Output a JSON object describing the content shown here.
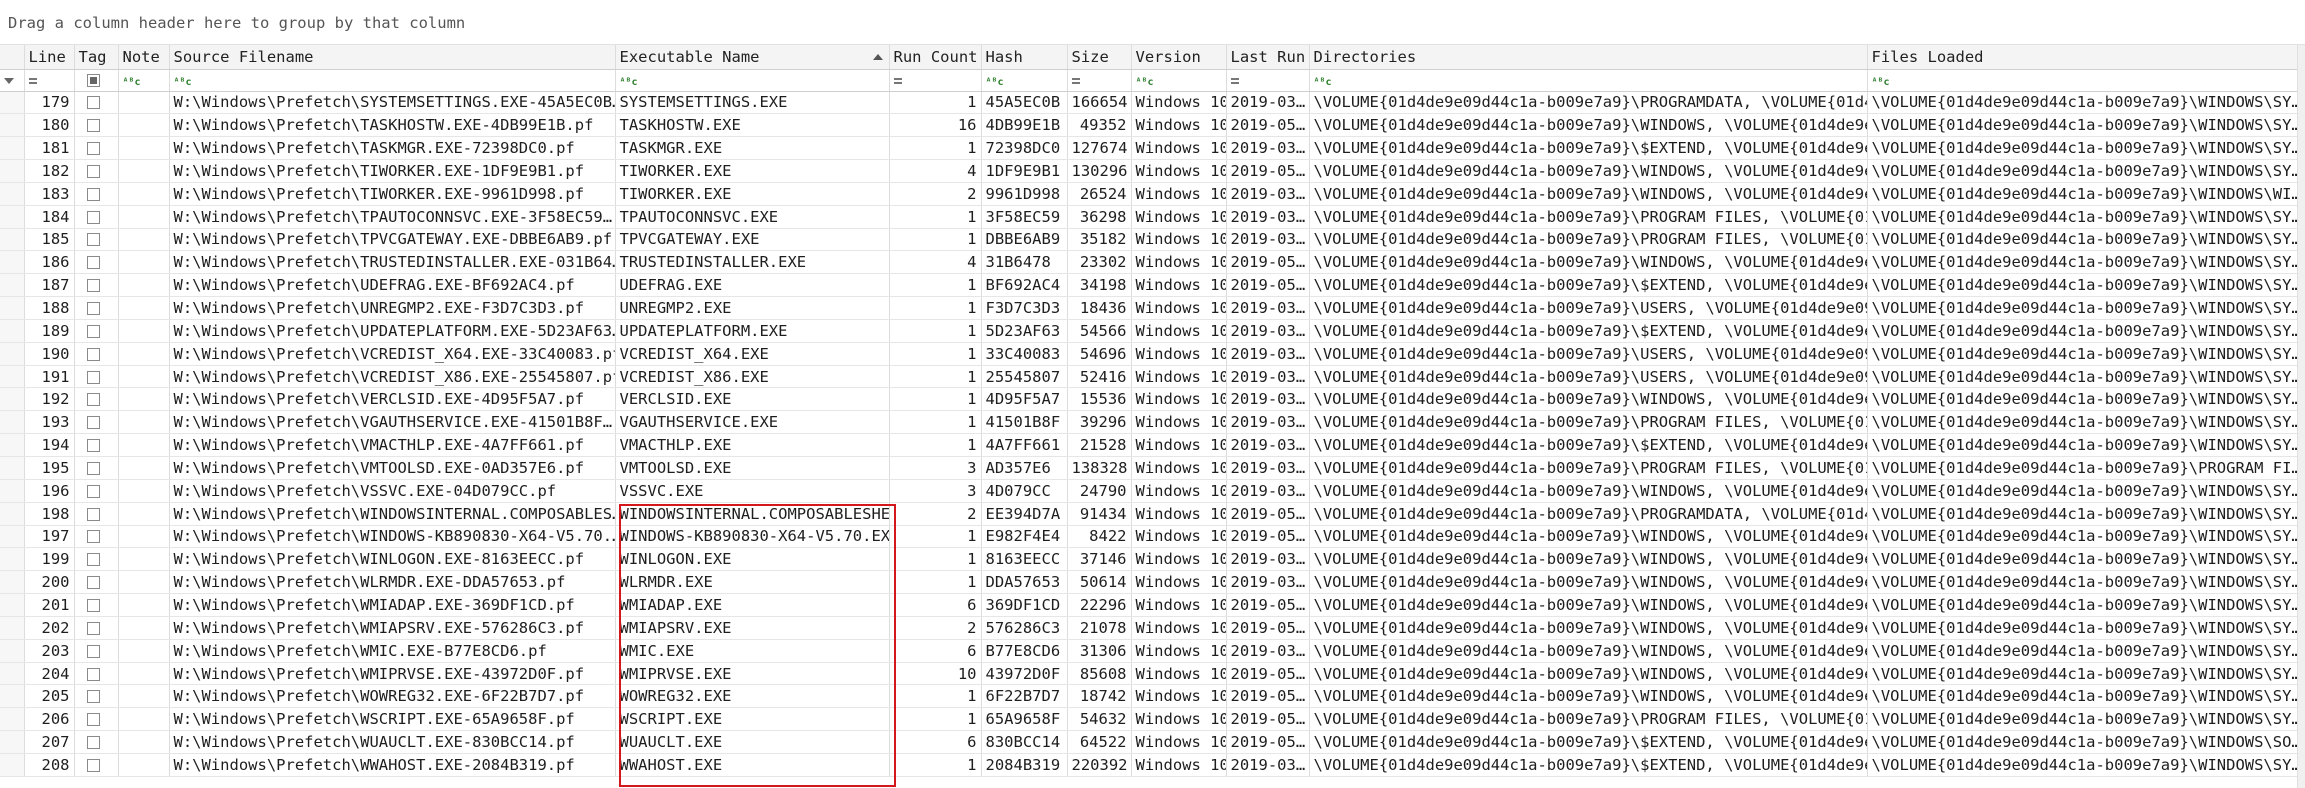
{
  "group_panel": {
    "text": "Drag a column header here to group by that column"
  },
  "columns": [
    "Line",
    "Tag",
    "Note",
    "Source Filename",
    "Executable Name",
    "Run Count",
    "Hash",
    "Size",
    "Version",
    "Last Run",
    "Directories",
    "Files Loaded"
  ],
  "rows": [
    {
      "line": "179",
      "src": "W:\\Windows\\Prefetch\\SYSTEMSETTINGS.EXE-45A5EC0B…",
      "exe": "SYSTEMSETTINGS.EXE",
      "run": "1",
      "hash": "45A5EC0B",
      "size": "166654",
      "ver": "Windows 10",
      "last": "2019-03…",
      "dirs": "\\VOLUME{01d4de9e09d44c1a-b009e7a9}\\PROGRAMDATA, \\VOLUME{01d4…",
      "files": "\\VOLUME{01d4de9e09d44c1a-b009e7a9}\\WINDOWS\\SY…"
    },
    {
      "line": "180",
      "src": "W:\\Windows\\Prefetch\\TASKHOSTW.EXE-4DB99E1B.pf",
      "exe": "TASKHOSTW.EXE",
      "run": "16",
      "hash": "4DB99E1B",
      "size": "49352",
      "ver": "Windows 10",
      "last": "2019-05…",
      "dirs": "\\VOLUME{01d4de9e09d44c1a-b009e7a9}\\WINDOWS, \\VOLUME{01d4de9e…",
      "files": "\\VOLUME{01d4de9e09d44c1a-b009e7a9}\\WINDOWS\\SY…"
    },
    {
      "line": "181",
      "src": "W:\\Windows\\Prefetch\\TASKMGR.EXE-72398DC0.pf",
      "exe": "TASKMGR.EXE",
      "run": "1",
      "hash": "72398DC0",
      "size": "127674",
      "ver": "Windows 10",
      "last": "2019-03…",
      "dirs": "\\VOLUME{01d4de9e09d44c1a-b009e7a9}\\$EXTEND, \\VOLUME{01d4de9e…",
      "files": "\\VOLUME{01d4de9e09d44c1a-b009e7a9}\\WINDOWS\\SY…"
    },
    {
      "line": "182",
      "src": "W:\\Windows\\Prefetch\\TIWORKER.EXE-1DF9E9B1.pf",
      "exe": "TIWORKER.EXE",
      "run": "4",
      "hash": "1DF9E9B1",
      "size": "130296",
      "ver": "Windows 10",
      "last": "2019-05…",
      "dirs": "\\VOLUME{01d4de9e09d44c1a-b009e7a9}\\WINDOWS, \\VOLUME{01d4de9e…",
      "files": "\\VOLUME{01d4de9e09d44c1a-b009e7a9}\\WINDOWS\\SY…"
    },
    {
      "line": "183",
      "src": "W:\\Windows\\Prefetch\\TIWORKER.EXE-9961D998.pf",
      "exe": "TIWORKER.EXE",
      "run": "2",
      "hash": "9961D998",
      "size": "26524",
      "ver": "Windows 10",
      "last": "2019-03…",
      "dirs": "\\VOLUME{01d4de9e09d44c1a-b009e7a9}\\WINDOWS, \\VOLUME{01d4de9e…",
      "files": "\\VOLUME{01d4de9e09d44c1a-b009e7a9}\\WINDOWS\\WI…"
    },
    {
      "line": "184",
      "src": "W:\\Windows\\Prefetch\\TPAUTOCONNSVC.EXE-3F58EC59…",
      "exe": "TPAUTOCONNSVC.EXE",
      "run": "1",
      "hash": "3F58EC59",
      "size": "36298",
      "ver": "Windows 10",
      "last": "2019-03…",
      "dirs": "\\VOLUME{01d4de9e09d44c1a-b009e7a9}\\PROGRAM FILES, \\VOLUME{01…",
      "files": "\\VOLUME{01d4de9e09d44c1a-b009e7a9}\\WINDOWS\\SY…"
    },
    {
      "line": "185",
      "src": "W:\\Windows\\Prefetch\\TPVCGATEWAY.EXE-DBBE6AB9.pf",
      "exe": "TPVCGATEWAY.EXE",
      "run": "1",
      "hash": "DBBE6AB9",
      "size": "35182",
      "ver": "Windows 10",
      "last": "2019-03…",
      "dirs": "\\VOLUME{01d4de9e09d44c1a-b009e7a9}\\PROGRAM FILES, \\VOLUME{01…",
      "files": "\\VOLUME{01d4de9e09d44c1a-b009e7a9}\\WINDOWS\\SY…"
    },
    {
      "line": "186",
      "src": "W:\\Windows\\Prefetch\\TRUSTEDINSTALLER.EXE-031B64…",
      "exe": "TRUSTEDINSTALLER.EXE",
      "run": "4",
      "hash": "31B6478",
      "size": "23302",
      "ver": "Windows 10",
      "last": "2019-05…",
      "dirs": "\\VOLUME{01d4de9e09d44c1a-b009e7a9}\\WINDOWS, \\VOLUME{01d4de9e…",
      "files": "\\VOLUME{01d4de9e09d44c1a-b009e7a9}\\WINDOWS\\SY…"
    },
    {
      "line": "187",
      "src": "W:\\Windows\\Prefetch\\UDEFRAG.EXE-BF692AC4.pf",
      "exe": "UDEFRAG.EXE",
      "run": "1",
      "hash": "BF692AC4",
      "size": "34198",
      "ver": "Windows 10",
      "last": "2019-05…",
      "dirs": "\\VOLUME{01d4de9e09d44c1a-b009e7a9}\\$EXTEND, \\VOLUME{01d4de9e…",
      "files": "\\VOLUME{01d4de9e09d44c1a-b009e7a9}\\WINDOWS\\SY…"
    },
    {
      "line": "188",
      "src": "W:\\Windows\\Prefetch\\UNREGMP2.EXE-F3D7C3D3.pf",
      "exe": "UNREGMP2.EXE",
      "run": "1",
      "hash": "F3D7C3D3",
      "size": "18436",
      "ver": "Windows 10",
      "last": "2019-03…",
      "dirs": "\\VOLUME{01d4de9e09d44c1a-b009e7a9}\\USERS, \\VOLUME{01d4de9e09…",
      "files": "\\VOLUME{01d4de9e09d44c1a-b009e7a9}\\WINDOWS\\SY…"
    },
    {
      "line": "189",
      "src": "W:\\Windows\\Prefetch\\UPDATEPLATFORM.EXE-5D23AF63…",
      "exe": "UPDATEPLATFORM.EXE",
      "run": "1",
      "hash": "5D23AF63",
      "size": "54566",
      "ver": "Windows 10",
      "last": "2019-03…",
      "dirs": "\\VOLUME{01d4de9e09d44c1a-b009e7a9}\\$EXTEND, \\VOLUME{01d4de9e…",
      "files": "\\VOLUME{01d4de9e09d44c1a-b009e7a9}\\WINDOWS\\SY…"
    },
    {
      "line": "190",
      "src": "W:\\Windows\\Prefetch\\VCREDIST_X64.EXE-33C40083.pf",
      "exe": "VCREDIST_X64.EXE",
      "run": "1",
      "hash": "33C40083",
      "size": "54696",
      "ver": "Windows 10",
      "last": "2019-03…",
      "dirs": "\\VOLUME{01d4de9e09d44c1a-b009e7a9}\\USERS, \\VOLUME{01d4de9e09…",
      "files": "\\VOLUME{01d4de9e09d44c1a-b009e7a9}\\WINDOWS\\SY…"
    },
    {
      "line": "191",
      "src": "W:\\Windows\\Prefetch\\VCREDIST_X86.EXE-25545807.pf",
      "exe": "VCREDIST_X86.EXE",
      "run": "1",
      "hash": "25545807",
      "size": "52416",
      "ver": "Windows 10",
      "last": "2019-03…",
      "dirs": "\\VOLUME{01d4de9e09d44c1a-b009e7a9}\\USERS, \\VOLUME{01d4de9e09…",
      "files": "\\VOLUME{01d4de9e09d44c1a-b009e7a9}\\WINDOWS\\SY…"
    },
    {
      "line": "192",
      "src": "W:\\Windows\\Prefetch\\VERCLSID.EXE-4D95F5A7.pf",
      "exe": "VERCLSID.EXE",
      "run": "1",
      "hash": "4D95F5A7",
      "size": "15536",
      "ver": "Windows 10",
      "last": "2019-03…",
      "dirs": "\\VOLUME{01d4de9e09d44c1a-b009e7a9}\\WINDOWS, \\VOLUME{01d4de9e…",
      "files": "\\VOLUME{01d4de9e09d44c1a-b009e7a9}\\WINDOWS\\SY…"
    },
    {
      "line": "193",
      "src": "W:\\Windows\\Prefetch\\VGAUTHSERVICE.EXE-41501B8F…",
      "exe": "VGAUTHSERVICE.EXE",
      "run": "1",
      "hash": "41501B8F",
      "size": "39296",
      "ver": "Windows 10",
      "last": "2019-03…",
      "dirs": "\\VOLUME{01d4de9e09d44c1a-b009e7a9}\\PROGRAM FILES, \\VOLUME{01…",
      "files": "\\VOLUME{01d4de9e09d44c1a-b009e7a9}\\WINDOWS\\SY…"
    },
    {
      "line": "194",
      "src": "W:\\Windows\\Prefetch\\VMACTHLP.EXE-4A7FF661.pf",
      "exe": "VMACTHLP.EXE",
      "run": "1",
      "hash": "4A7FF661",
      "size": "21528",
      "ver": "Windows 10",
      "last": "2019-03…",
      "dirs": "\\VOLUME{01d4de9e09d44c1a-b009e7a9}\\$EXTEND, \\VOLUME{01d4de9e…",
      "files": "\\VOLUME{01d4de9e09d44c1a-b009e7a9}\\WINDOWS\\SY…"
    },
    {
      "line": "195",
      "src": "W:\\Windows\\Prefetch\\VMTOOLSD.EXE-0AD357E6.pf",
      "exe": "VMTOOLSD.EXE",
      "run": "3",
      "hash": "AD357E6",
      "size": "138328",
      "ver": "Windows 10",
      "last": "2019-03…",
      "dirs": "\\VOLUME{01d4de9e09d44c1a-b009e7a9}\\PROGRAM FILES, \\VOLUME{01…",
      "files": "\\VOLUME{01d4de9e09d44c1a-b009e7a9}\\PROGRAM FI…"
    },
    {
      "line": "196",
      "src": "W:\\Windows\\Prefetch\\VSSVC.EXE-04D079CC.pf",
      "exe": "VSSVC.EXE",
      "run": "3",
      "hash": "4D079CC",
      "size": "24790",
      "ver": "Windows 10",
      "last": "2019-03…",
      "dirs": "\\VOLUME{01d4de9e09d44c1a-b009e7a9}\\WINDOWS, \\VOLUME{01d4de9e…",
      "files": "\\VOLUME{01d4de9e09d44c1a-b009e7a9}\\WINDOWS\\SY…"
    },
    {
      "line": "198",
      "src": "W:\\Windows\\Prefetch\\WINDOWSINTERNAL.COMPOSABLES…",
      "exe": "WINDOWSINTERNAL.COMPOSABLESHE",
      "run": "2",
      "hash": "EE394D7A",
      "size": "91434",
      "ver": "Windows 10",
      "last": "2019-05…",
      "dirs": "\\VOLUME{01d4de9e09d44c1a-b009e7a9}\\PROGRAMDATA, \\VOLUME{01d4…",
      "files": "\\VOLUME{01d4de9e09d44c1a-b009e7a9}\\WINDOWS\\SY…"
    },
    {
      "line": "197",
      "src": "W:\\Windows\\Prefetch\\WINDOWS-KB890830-X64-V5.70.…",
      "exe": "WINDOWS-KB890830-X64-V5.70.EX",
      "run": "1",
      "hash": "E982F4E4",
      "size": "8422",
      "ver": "Windows 10",
      "last": "2019-05…",
      "dirs": "\\VOLUME{01d4de9e09d44c1a-b009e7a9}\\WINDOWS, \\VOLUME{01d4de9e…",
      "files": "\\VOLUME{01d4de9e09d44c1a-b009e7a9}\\WINDOWS\\SY…"
    },
    {
      "line": "199",
      "src": "W:\\Windows\\Prefetch\\WINLOGON.EXE-8163EECC.pf",
      "exe": "WINLOGON.EXE",
      "run": "1",
      "hash": "8163EECC",
      "size": "37146",
      "ver": "Windows 10",
      "last": "2019-03…",
      "dirs": "\\VOLUME{01d4de9e09d44c1a-b009e7a9}\\WINDOWS, \\VOLUME{01d4de9e…",
      "files": "\\VOLUME{01d4de9e09d44c1a-b009e7a9}\\WINDOWS\\SY…"
    },
    {
      "line": "200",
      "src": "W:\\Windows\\Prefetch\\WLRMDR.EXE-DDA57653.pf",
      "exe": "WLRMDR.EXE",
      "run": "1",
      "hash": "DDA57653",
      "size": "50614",
      "ver": "Windows 10",
      "last": "2019-03…",
      "dirs": "\\VOLUME{01d4de9e09d44c1a-b009e7a9}\\WINDOWS, \\VOLUME{01d4de9e…",
      "files": "\\VOLUME{01d4de9e09d44c1a-b009e7a9}\\WINDOWS\\SY…"
    },
    {
      "line": "201",
      "src": "W:\\Windows\\Prefetch\\WMIADAP.EXE-369DF1CD.pf",
      "exe": "WMIADAP.EXE",
      "run": "6",
      "hash": "369DF1CD",
      "size": "22296",
      "ver": "Windows 10",
      "last": "2019-05…",
      "dirs": "\\VOLUME{01d4de9e09d44c1a-b009e7a9}\\WINDOWS, \\VOLUME{01d4de9e…",
      "files": "\\VOLUME{01d4de9e09d44c1a-b009e7a9}\\WINDOWS\\SY…"
    },
    {
      "line": "202",
      "src": "W:\\Windows\\Prefetch\\WMIAPSRV.EXE-576286C3.pf",
      "exe": "WMIAPSRV.EXE",
      "run": "2",
      "hash": "576286C3",
      "size": "21078",
      "ver": "Windows 10",
      "last": "2019-05…",
      "dirs": "\\VOLUME{01d4de9e09d44c1a-b009e7a9}\\WINDOWS, \\VOLUME{01d4de9e…",
      "files": "\\VOLUME{01d4de9e09d44c1a-b009e7a9}\\WINDOWS\\SY…"
    },
    {
      "line": "203",
      "src": "W:\\Windows\\Prefetch\\WMIC.EXE-B77E8CD6.pf",
      "exe": "WMIC.EXE",
      "run": "6",
      "hash": "B77E8CD6",
      "size": "31306",
      "ver": "Windows 10",
      "last": "2019-03…",
      "dirs": "\\VOLUME{01d4de9e09d44c1a-b009e7a9}\\WINDOWS, \\VOLUME{01d4de9e…",
      "files": "\\VOLUME{01d4de9e09d44c1a-b009e7a9}\\WINDOWS\\SY…"
    },
    {
      "line": "204",
      "src": "W:\\Windows\\Prefetch\\WMIPRVSE.EXE-43972D0F.pf",
      "exe": "WMIPRVSE.EXE",
      "run": "10",
      "hash": "43972D0F",
      "size": "85608",
      "ver": "Windows 10",
      "last": "2019-05…",
      "dirs": "\\VOLUME{01d4de9e09d44c1a-b009e7a9}\\WINDOWS, \\VOLUME{01d4de9e…",
      "files": "\\VOLUME{01d4de9e09d44c1a-b009e7a9}\\WINDOWS\\SY…"
    },
    {
      "line": "205",
      "src": "W:\\Windows\\Prefetch\\WOWREG32.EXE-6F22B7D7.pf",
      "exe": "WOWREG32.EXE",
      "run": "1",
      "hash": "6F22B7D7",
      "size": "18742",
      "ver": "Windows 10",
      "last": "2019-05…",
      "dirs": "\\VOLUME{01d4de9e09d44c1a-b009e7a9}\\WINDOWS, \\VOLUME{01d4de9e…",
      "files": "\\VOLUME{01d4de9e09d44c1a-b009e7a9}\\WINDOWS\\SY…"
    },
    {
      "line": "206",
      "src": "W:\\Windows\\Prefetch\\WSCRIPT.EXE-65A9658F.pf",
      "exe": "WSCRIPT.EXE",
      "run": "1",
      "hash": "65A9658F",
      "size": "54632",
      "ver": "Windows 10",
      "last": "2019-05…",
      "dirs": "\\VOLUME{01d4de9e09d44c1a-b009e7a9}\\PROGRAM FILES, \\VOLUME{01…",
      "files": "\\VOLUME{01d4de9e09d44c1a-b009e7a9}\\WINDOWS\\SY…"
    },
    {
      "line": "207",
      "src": "W:\\Windows\\Prefetch\\WUAUCLT.EXE-830BCC14.pf",
      "exe": "WUAUCLT.EXE",
      "run": "6",
      "hash": "830BCC14",
      "size": "64522",
      "ver": "Windows 10",
      "last": "2019-05…",
      "dirs": "\\VOLUME{01d4de9e09d44c1a-b009e7a9}\\$EXTEND, \\VOLUME{01d4de9e…",
      "files": "\\VOLUME{01d4de9e09d44c1a-b009e7a9}\\WINDOWS\\SO…"
    },
    {
      "line": "208",
      "src": "W:\\Windows\\Prefetch\\WWAHOST.EXE-2084B319.pf",
      "exe": "WWAHOST.EXE",
      "run": "1",
      "hash": "2084B319",
      "size": "220392",
      "ver": "Windows 10",
      "last": "2019-03…",
      "dirs": "\\VOLUME{01d4de9e09d44c1a-b009e7a9}\\$EXTEND, \\VOLUME{01d4de9e…",
      "files": "\\VOLUME{01d4de9e09d44c1a-b009e7a9}\\WINDOWS\\SY…"
    }
  ],
  "colors": {
    "highlight": "#d4171c",
    "header_bg": "#f4f4f4",
    "filter_icon": "#2d7d2d"
  },
  "icons": {
    "filter_row": "funnel-icon",
    "equals": "equals-filter-icon",
    "contains": "abc-contains-icon",
    "sort": "sort-ascending-icon"
  }
}
